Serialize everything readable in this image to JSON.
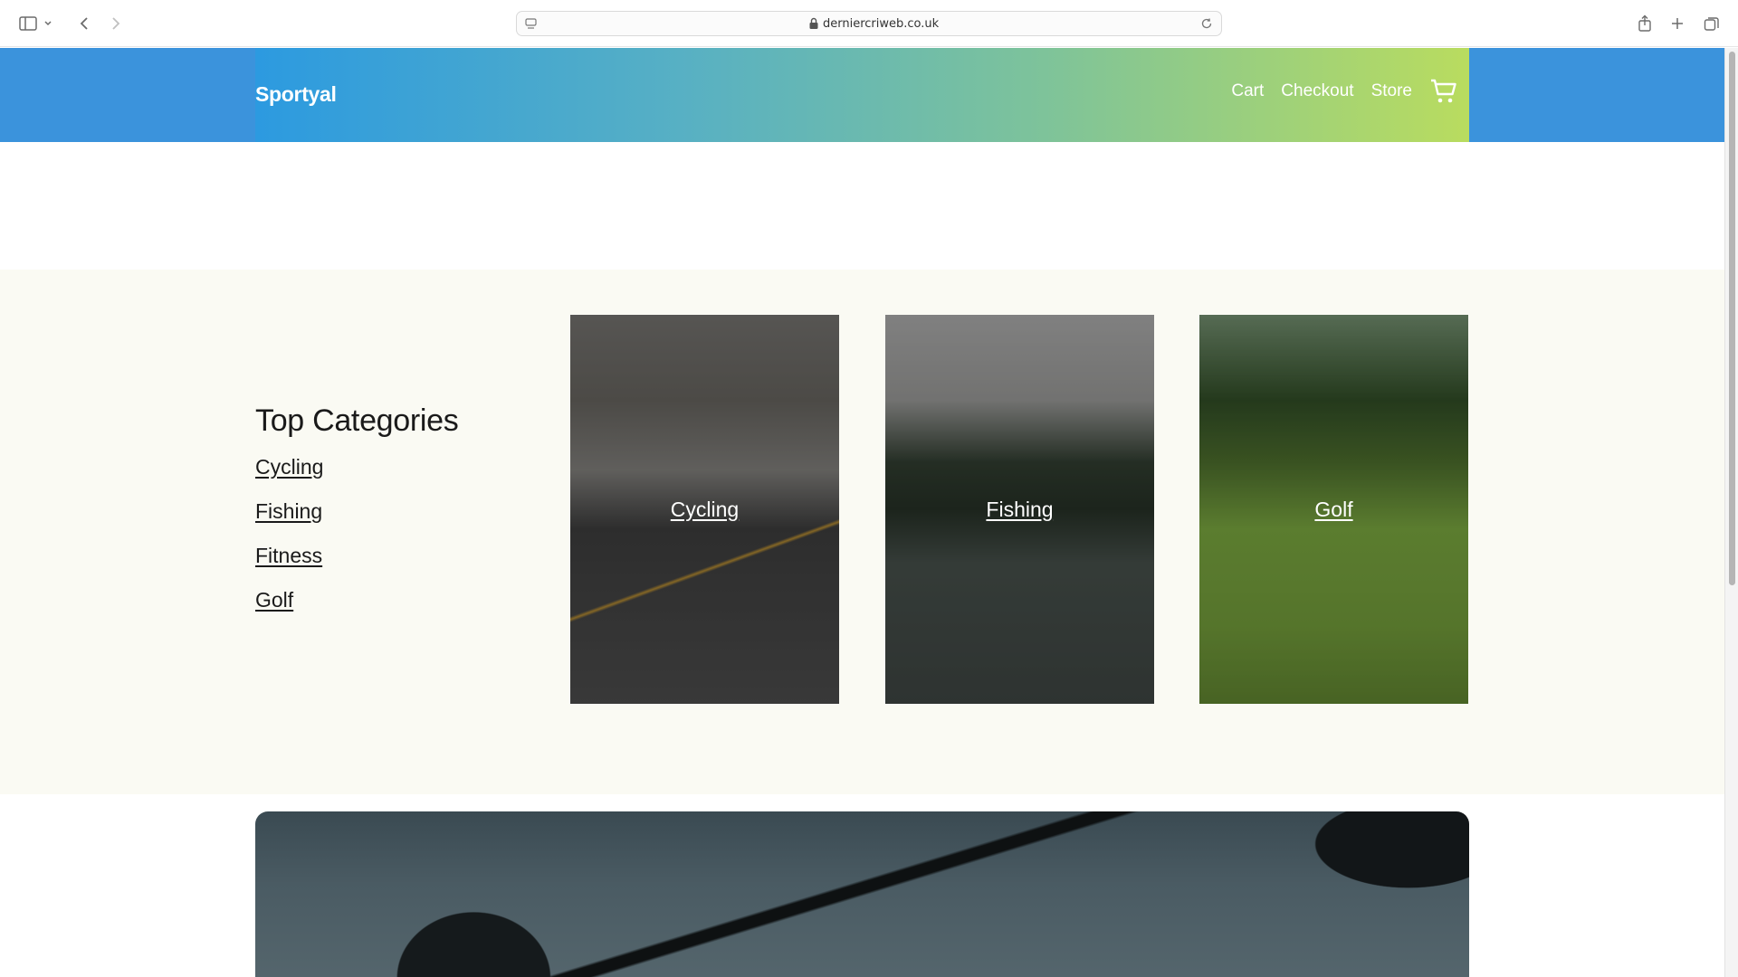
{
  "browser": {
    "url": "derniercriweb.co.uk"
  },
  "header": {
    "brand": "Sportyal",
    "nav": [
      "Cart",
      "Checkout",
      "Store"
    ],
    "gradient_colors": [
      "#2c9ae0",
      "#57b0c4",
      "#7ec39a",
      "#b9dc5f"
    ],
    "background_color": "#3b93dc"
  },
  "categories": {
    "title": "Top Categories",
    "list": [
      "Cycling",
      "Fishing",
      "Fitness",
      "Golf"
    ],
    "cards": [
      {
        "label": "Cycling",
        "image": "road-cycling-race-photo"
      },
      {
        "label": "Fishing",
        "image": "fly-fishing-reel-photo"
      },
      {
        "label": "Golf",
        "image": "golf-ball-on-green-photo"
      }
    ]
  },
  "banner": {
    "image": "barbell-deadlift-photo"
  },
  "icons": {
    "sidebar": "sidebar-icon",
    "back": "chevron-left-icon",
    "forward": "chevron-right-icon",
    "share": "share-icon",
    "new_tab": "plus-icon",
    "tabs": "tabs-overview-icon",
    "cart": "shopping-cart-icon"
  }
}
